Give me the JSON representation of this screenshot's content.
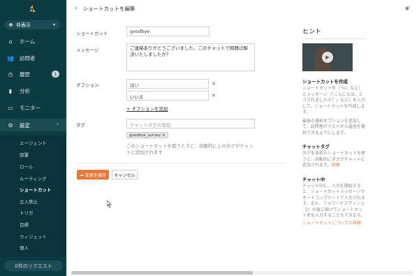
{
  "sidebar": {
    "status": "非表示",
    "nav": [
      {
        "label": "ホーム",
        "icon": "home-icon"
      },
      {
        "label": "訪問者",
        "icon": "visitors-icon"
      },
      {
        "label": "履歴",
        "icon": "history-icon",
        "badge": "1"
      },
      {
        "label": "分析",
        "icon": "analytics-icon"
      },
      {
        "label": "モニター",
        "icon": "monitor-icon"
      },
      {
        "label": "設定",
        "icon": "settings-icon"
      }
    ],
    "subnav": [
      "エージェント",
      "部署",
      "ロール",
      "ルーティング",
      "ショートカット",
      "立入禁止",
      "トリガ",
      "目標",
      "ウィジェット",
      "個人"
    ],
    "requests": "0件のリクエスト"
  },
  "header": {
    "title": "ショートカットを編集"
  },
  "form": {
    "shortcut_label": "ショートカット",
    "shortcut_value": "goodbye",
    "message_label": "メッセージ",
    "message_value": "ご連絡ありがとうございました。このチャットで問題は解決いたしましたか？",
    "options_label": "オプション",
    "options": [
      "はい",
      "いいえ"
    ],
    "add_option": "+ オプションを追加",
    "tag_label": "タグ",
    "tag_placeholder": "チャットタグの追加",
    "tag_chip": "goodbye_survey",
    "tag_hint": "このショートカットを使うときに、自動的に上のタグがチャットに追加されます",
    "save": "変更を保存",
    "cancel": "キャンセル"
  },
  "hints": {
    "title": "ヒント",
    "sections": [
      {
        "head": "ショートカットを作成",
        "text": "ショートカット名（「hi」など）とメッセージ（「こんにちは、どうされましたか？」など）を入力して、ショートカットを作成します。",
        "text2": "最後の選択オプションを追加して、訪問者がリストから返信を選択できるようにします。"
      },
      {
        "head": "チャットタグ",
        "text": "タグを含めたショートカットを使うと、自動的にタグがチャットに追加されます。",
        "link": "詳細"
      },
      {
        "head": "チャット中",
        "text": "チャット中に、入力を開始すると、ショートカットメッセージがオートコンプリートで入力されます。また、フォワードスラッシュ（/）の後に続けてショートカット名を入力することもできます。",
        "link": "ショートカットについての詳細"
      }
    ]
  },
  "colors": {
    "sidebar": "#0d3b44",
    "accent": "#e8793a"
  }
}
